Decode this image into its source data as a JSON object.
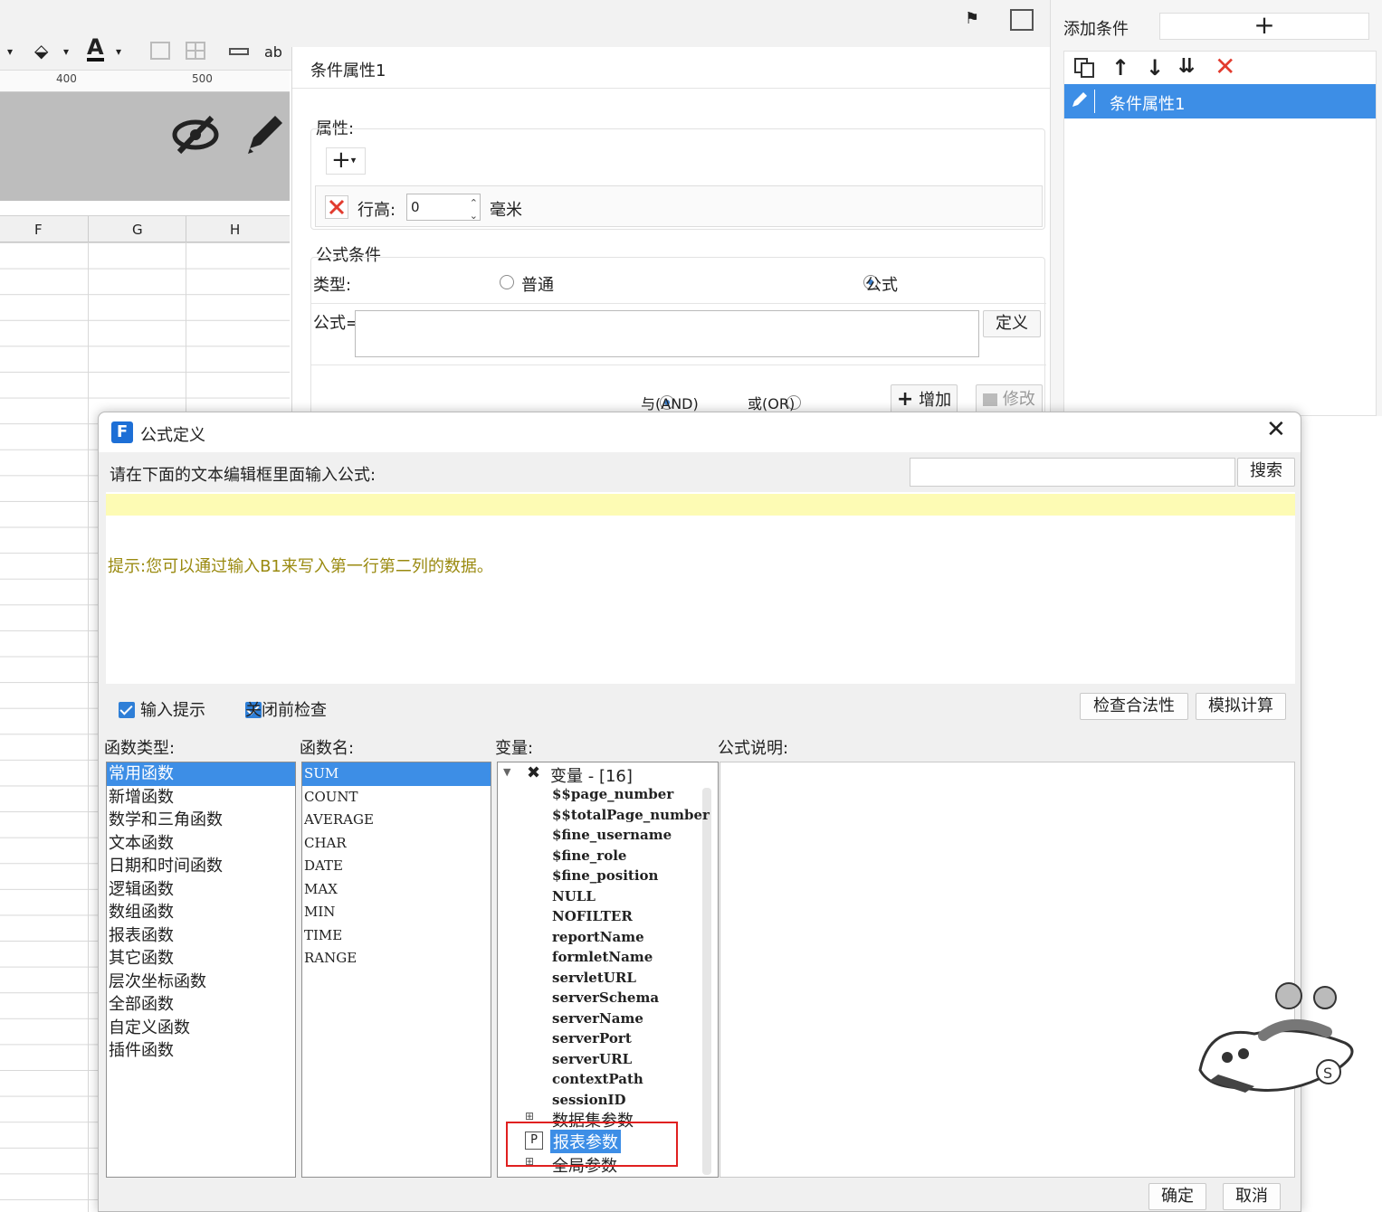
{
  "designer": {
    "ruler_marks": [
      "400",
      "500"
    ],
    "columns": [
      "F",
      "G",
      "H"
    ]
  },
  "condition_panel": {
    "title": "条件属性1",
    "properties_label": "属性:",
    "row_height_label": "行高:",
    "row_height_value": "0",
    "row_height_unit": "毫米",
    "formula_condition_label": "公式条件",
    "type_label": "类型:",
    "type_options": [
      "普通",
      "公式"
    ],
    "type_selected": "公式",
    "formula_label": "公式=",
    "formula_value": "",
    "define_button": "定义",
    "logic_and": "与(AND)",
    "logic_or": "或(OR)",
    "logic_selected": "与(AND)",
    "add_button": "增加",
    "modify_button": "修改"
  },
  "right_panel": {
    "add_condition_label": "添加条件",
    "conditions": [
      "条件属性1"
    ]
  },
  "dialog": {
    "title": "公式定义",
    "prompt": "请在下面的文本编辑框里面输入公式:",
    "search_value": "",
    "search_button": "搜索",
    "editor_value": "",
    "hint": "提示:您可以通过输入B1来写入第一行第二列的数据。",
    "input_hint_label": "输入提示",
    "input_hint_checked": true,
    "check_before_close_label": "关闭前检查",
    "check_before_close_checked": true,
    "check_validity_button": "检查合法性",
    "simulate_button": "模拟计算",
    "function_types_label": "函数类型:",
    "function_types": [
      "常用函数",
      "新增函数",
      "数学和三角函数",
      "文本函数",
      "日期和时间函数",
      "逻辑函数",
      "数组函数",
      "报表函数",
      "其它函数",
      "层次坐标函数",
      "全部函数",
      "自定义函数",
      "插件函数"
    ],
    "function_type_selected": "常用函数",
    "function_names_label": "函数名:",
    "function_names": [
      "SUM",
      "COUNT",
      "AVERAGE",
      "CHAR",
      "DATE",
      "MAX",
      "MIN",
      "TIME",
      "RANGE"
    ],
    "function_name_selected": "SUM",
    "variables_label": "变量:",
    "variables_root": "变量 - [16]",
    "variables": [
      "$$page_number",
      "$$totalPage_number",
      "$fine_username",
      "$fine_role",
      "$fine_position",
      "NULL",
      "NOFILTER",
      "reportName",
      "formletName",
      "servletURL",
      "serverSchema",
      "serverName",
      "serverPort",
      "serverURL",
      "contextPath",
      "sessionID"
    ],
    "param_groups": [
      "数据集参数",
      "报表参数",
      "全局参数"
    ],
    "param_group_selected": "报表参数",
    "description_label": "公式说明:",
    "ok_button": "确定",
    "cancel_button": "取消"
  },
  "colors": {
    "selection": "#3d8ee6",
    "hint_text": "#9a8a10",
    "editor_highlight": "#fdfbb4",
    "delete_red": "#e23b2e",
    "callout_red": "#e02020"
  }
}
